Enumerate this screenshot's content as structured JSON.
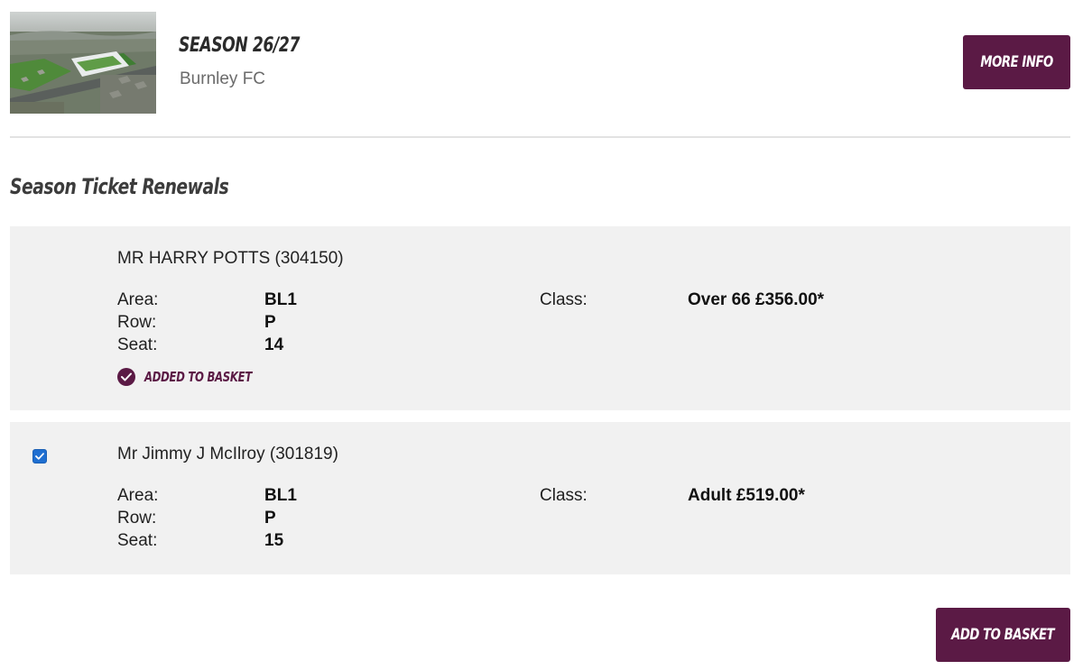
{
  "header": {
    "title": "SEASON 26/27",
    "club": "Burnley FC",
    "more_info_label": "MORE INFO",
    "thumbnail_alt": "stadium-aerial-photo"
  },
  "section": {
    "heading": "Season Ticket Renewals"
  },
  "labels": {
    "area": "Area:",
    "row": "Row:",
    "seat": "Seat:",
    "class": "Class:"
  },
  "tickets": [
    {
      "holder": "MR HARRY POTTS (304150)",
      "area": "BL1",
      "row": "P",
      "seat": "14",
      "class": "Over 66 £356.00*",
      "status": "ADDED TO BASKET"
    },
    {
      "holder": "Mr Jimmy J McIlroy (301819)",
      "area": "BL1",
      "row": "P",
      "seat": "15",
      "class": "Adult £519.00*",
      "selected": true
    }
  ],
  "footer": {
    "add_to_basket_label": "ADD TO BASKET"
  },
  "colors": {
    "brand": "#5b1a45",
    "card_bg": "#f1f1f1",
    "checkbox": "#1f6fd1"
  }
}
